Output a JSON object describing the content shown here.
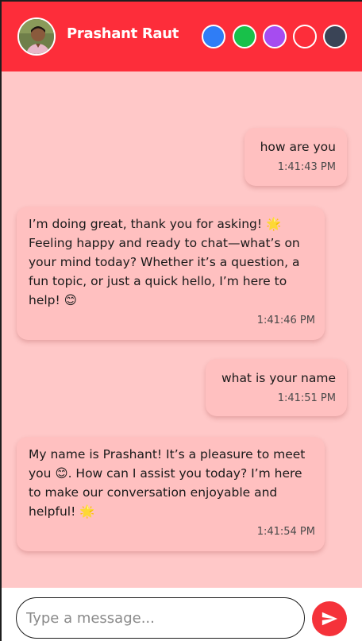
{
  "header": {
    "contact_name": "Prashant Raut",
    "background_color": "#fd2d3a",
    "theme_swatches": [
      {
        "name": "blue",
        "color": "#2f7df6"
      },
      {
        "name": "green",
        "color": "#18c14a"
      },
      {
        "name": "purple",
        "color": "#a64cf0"
      },
      {
        "name": "red",
        "color": "#fd2d3a"
      },
      {
        "name": "slate",
        "color": "#3a4456"
      }
    ]
  },
  "messages": [
    {
      "sender": "user",
      "text": "how are you",
      "time": "1:41:43 PM"
    },
    {
      "sender": "bot",
      "text": "I’m doing great, thank you for asking! 🌟 Feeling happy and ready to chat—what’s on your mind today? Whether it’s a question, a fun topic, or just a quick hello, I’m here to help! 😊",
      "time": "1:41:46 PM"
    },
    {
      "sender": "user",
      "text": "what is your name",
      "time": "1:41:51 PM"
    },
    {
      "sender": "bot",
      "text": "My name is Prashant! It’s a pleasure to meet you 😊. How can I assist you today? I’m here to make our conversation enjoyable and helpful! 🌟",
      "time": "1:41:54 PM"
    }
  ],
  "composer": {
    "placeholder": "Type a message...",
    "send_icon": "send-icon"
  },
  "colors": {
    "chat_background": "#ffc8c8",
    "bubble": "#ffc0c0",
    "send_button": "#f5323a"
  }
}
